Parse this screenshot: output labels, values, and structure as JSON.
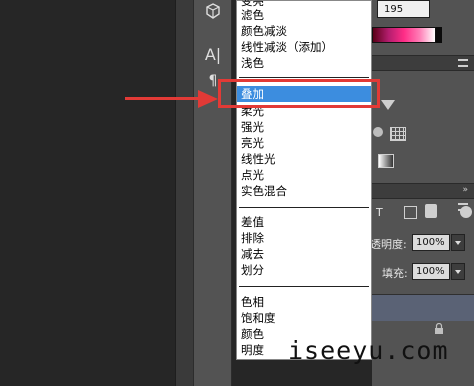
{
  "blend_menu": {
    "items": [
      {
        "label": "变亮",
        "selected": false
      },
      {
        "label": "滤色",
        "selected": false
      },
      {
        "label": "颜色减淡",
        "selected": false
      },
      {
        "label": "线性减淡（添加）",
        "selected": false
      },
      {
        "label": "浅色",
        "selected": false
      },
      {
        "label": "叠加",
        "selected": true
      },
      {
        "label": "柔光",
        "selected": false
      },
      {
        "label": "强光",
        "selected": false
      },
      {
        "label": "亮光",
        "selected": false
      },
      {
        "label": "线性光",
        "selected": false
      },
      {
        "label": "点光",
        "selected": false
      },
      {
        "label": "实色混合",
        "selected": false
      },
      {
        "label": "差值",
        "selected": false
      },
      {
        "label": "排除",
        "selected": false
      },
      {
        "label": "减去",
        "selected": false
      },
      {
        "label": "划分",
        "selected": false
      },
      {
        "label": "色相",
        "selected": false
      },
      {
        "label": "饱和度",
        "selected": false
      },
      {
        "label": "颜色",
        "selected": false
      },
      {
        "label": "明度",
        "selected": false
      }
    ]
  },
  "color_panel": {
    "value": "195"
  },
  "layers_panel": {
    "opacity_label": "透明度:",
    "opacity_value": "100%",
    "fill_label": "填充:",
    "fill_value": "100%"
  },
  "tools": {
    "cube_icon": "3d-cube-icon",
    "text_icon": "A|",
    "paragraph_icon": "paragraph-icon"
  },
  "annotation": {
    "color": "#e23a36"
  },
  "watermark": "iseeyu.com"
}
